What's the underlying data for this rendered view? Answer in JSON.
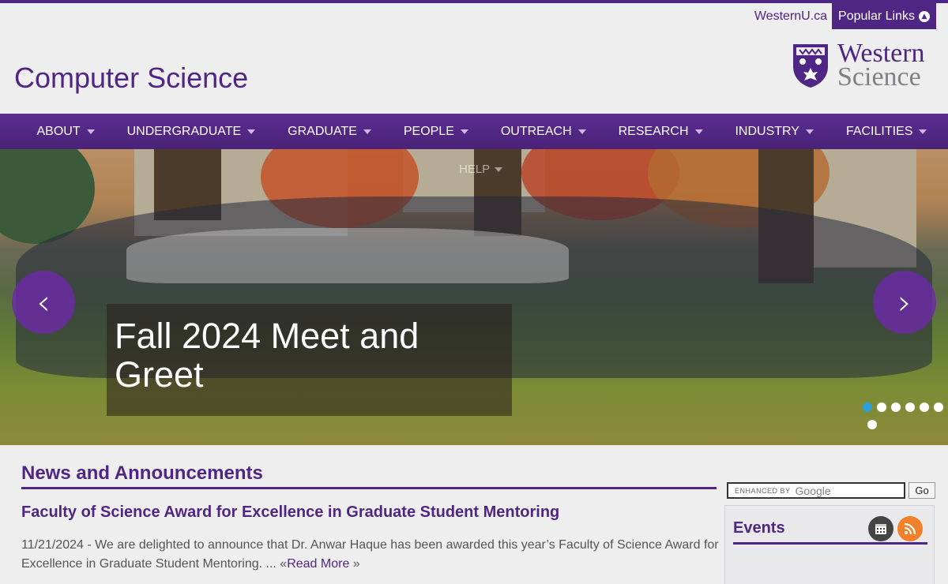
{
  "colors": {
    "purple": "#4f2683",
    "accent_blue": "#2a9fd8",
    "rss_orange": "#f0802a"
  },
  "utility": {
    "westernu_link": "WesternU.ca",
    "popular_links": "Popular Links",
    "popular_icon": "chevron-up-icon"
  },
  "header": {
    "site_title": "Computer Science",
    "logo_line1": "Western",
    "logo_line2": "Science"
  },
  "nav": {
    "items": [
      {
        "label": "ABOUT"
      },
      {
        "label": "UNDERGRADUATE"
      },
      {
        "label": "GRADUATE"
      },
      {
        "label": "PEOPLE"
      },
      {
        "label": "OUTREACH"
      },
      {
        "label": "RESEARCH"
      },
      {
        "label": "INDUSTRY"
      },
      {
        "label": "FACILITIES"
      }
    ],
    "help_label": "HELP"
  },
  "carousel": {
    "caption": "Fall 2024 Meet and Greet",
    "slide_count": 7,
    "active_slide": 1,
    "prev_icon": "chevron-left-icon",
    "next_icon": "chevron-right-icon"
  },
  "news": {
    "heading": "News and Announcements",
    "article_title": "Faculty of Science Award for Excellence in Graduate Student Mentoring",
    "article_body": "11/21/2024 - We are delighted to announce that Dr. Anwar Haque has been awarded this year’s Faculty of Science Award for Excellence in Graduate Student Mentoring. ... «",
    "read_more": "Read More",
    "read_more_suffix": " »"
  },
  "search": {
    "enhanced_by": "ENHANCED BY",
    "provider": "Google",
    "go_label": "Go"
  },
  "events": {
    "title": "Events",
    "calendar_icon": "calendar-icon",
    "rss_icon": "rss-icon"
  }
}
